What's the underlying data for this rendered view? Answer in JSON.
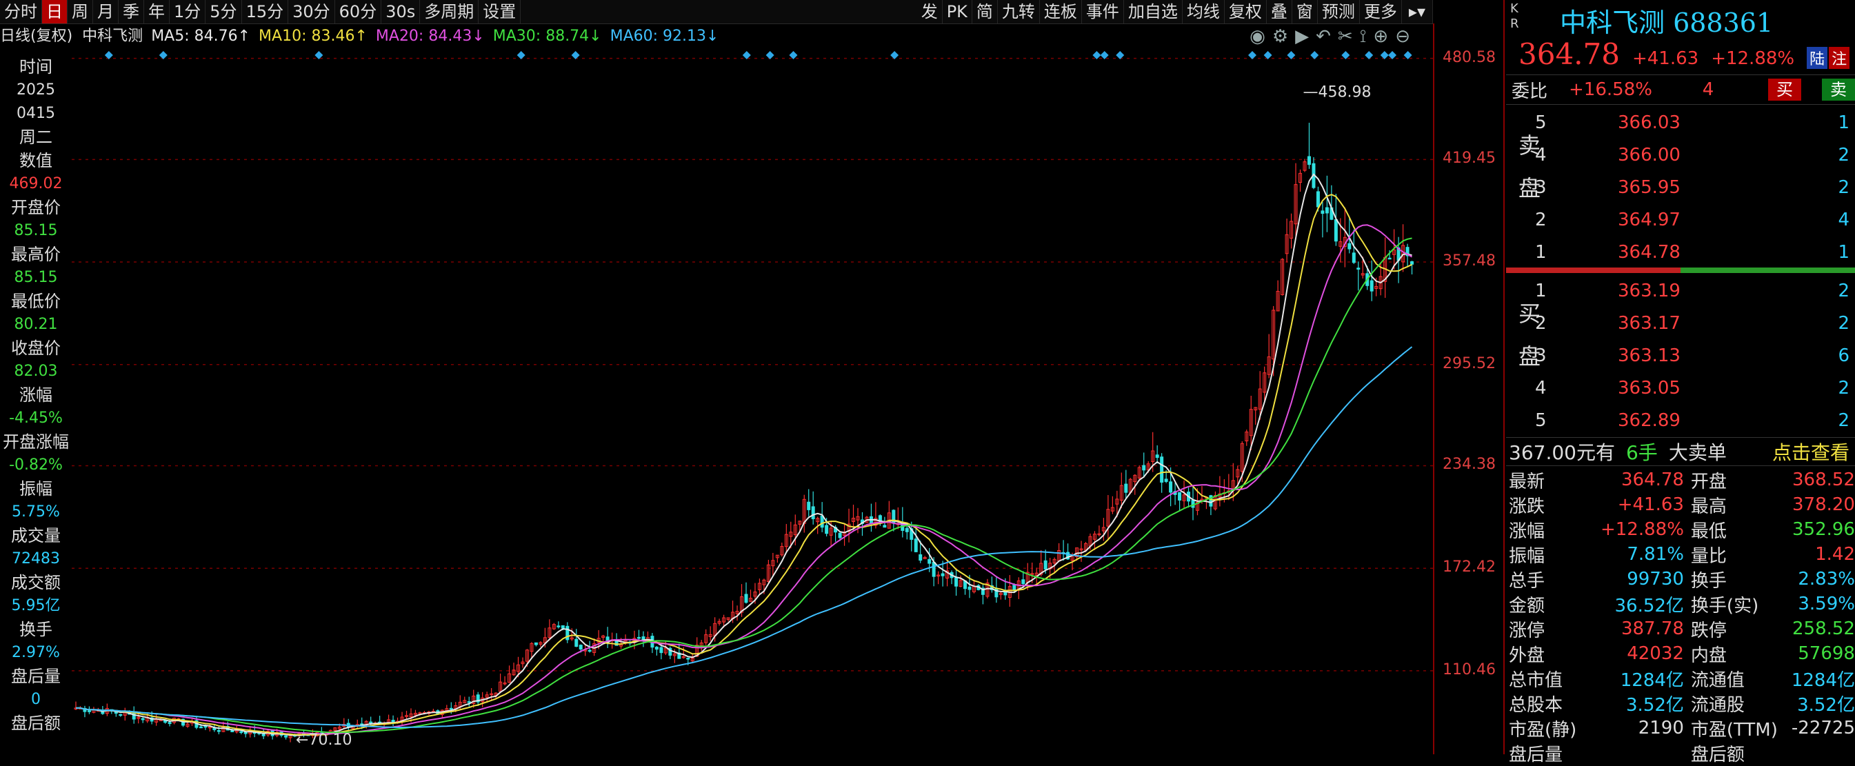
{
  "toolbar": {
    "left": [
      "分时",
      "日",
      "周",
      "月",
      "季",
      "年",
      "1分",
      "5分",
      "15分",
      "30分",
      "60分",
      "30s",
      "多周期",
      "设置"
    ],
    "active_index": 1,
    "right": [
      "发",
      "PK",
      "简",
      "九转",
      "连板",
      "事件",
      "加自选",
      "均线",
      "复权",
      "叠",
      "窗",
      "预测",
      "更多"
    ]
  },
  "legend": {
    "period": "日线(复权)",
    "stock": "中科飞测",
    "ma": [
      {
        "label": "MA5: 84.76↑",
        "color": "#e8e8e8"
      },
      {
        "label": "MA10: 83.46↑",
        "color": "#f0e040"
      },
      {
        "label": "MA20: 84.43↓",
        "color": "#e050e0"
      },
      {
        "label": "MA30: 88.74↓",
        "color": "#40e040"
      },
      {
        "label": "MA60: 92.13↓",
        "color": "#40c0ff"
      }
    ]
  },
  "left_panel": [
    {
      "label": "时间",
      "value": "2025"
    },
    {
      "label": "",
      "value": "0415"
    },
    {
      "label": "周二",
      "value": ""
    },
    {
      "label": "数值",
      "value": "469.02"
    },
    {
      "label": "开盘价",
      "value": "85.15"
    },
    {
      "label": "最高价",
      "value": "85.15"
    },
    {
      "label": "最低价",
      "value": "80.21"
    },
    {
      "label": "收盘价",
      "value": "82.03"
    },
    {
      "label": "涨幅",
      "value": "-4.45%"
    },
    {
      "label": "开盘涨幅",
      "value": "-0.82%"
    },
    {
      "label": "振幅",
      "value": "5.75%"
    },
    {
      "label": "成交量",
      "value": "72483"
    },
    {
      "label": "成交额",
      "value": "5.95亿"
    },
    {
      "label": "换手",
      "value": "2.97%"
    },
    {
      "label": "盘后量",
      "value": "0"
    },
    {
      "label": "盘后额",
      "value": ""
    }
  ],
  "left_colors": {
    "2025": "#ddd",
    "0415": "#ddd",
    "469.02": "#ff4040",
    "85.15": "#40e040",
    "80.21": "#40e040",
    "82.03": "#40e040",
    "-4.45%": "#40e040",
    "-0.82%": "#40e040",
    "5.75%": "#2ed0ff",
    "72483": "#2ed0ff",
    "5.95亿": "#2ed0ff",
    "2.97%": "#2ed0ff",
    "0": "#2ed0ff"
  },
  "axis_labels": [
    "480.58",
    "419.45",
    "357.48",
    "295.52",
    "234.38",
    "172.42",
    "110.46"
  ],
  "chart_data": {
    "type": "line",
    "series": [
      {
        "name": "MA5",
        "color": "#e8e8e8"
      },
      {
        "name": "MA10",
        "color": "#f0e040"
      },
      {
        "name": "MA20",
        "color": "#e050e0"
      },
      {
        "name": "MA30",
        "color": "#40e040"
      },
      {
        "name": "MA60",
        "color": "#40c0ff"
      }
    ],
    "ylim": [
      60,
      485
    ],
    "gridlines": [
      480.58,
      419.45,
      357.48,
      295.52,
      234.38,
      172.42,
      110.46
    ],
    "annotations": [
      {
        "text": "458.98",
        "value": 458.98
      },
      {
        "text": "←70.10",
        "value": 70.1
      }
    ],
    "close_path": [
      [
        0,
        88
      ],
      [
        20,
        86
      ],
      [
        40,
        82
      ],
      [
        60,
        80
      ],
      [
        80,
        76
      ],
      [
        100,
        74
      ],
      [
        120,
        72
      ],
      [
        130,
        71
      ],
      [
        150,
        74
      ],
      [
        170,
        78
      ],
      [
        190,
        80
      ],
      [
        210,
        84
      ],
      [
        230,
        90
      ],
      [
        250,
        96
      ],
      [
        260,
        104
      ],
      [
        270,
        118
      ],
      [
        280,
        130
      ],
      [
        290,
        138
      ],
      [
        300,
        128
      ],
      [
        310,
        125
      ],
      [
        320,
        130
      ],
      [
        330,
        128
      ],
      [
        340,
        132
      ],
      [
        350,
        126
      ],
      [
        360,
        122
      ],
      [
        370,
        118
      ],
      [
        380,
        130
      ],
      [
        390,
        140
      ],
      [
        400,
        150
      ],
      [
        410,
        160
      ],
      [
        420,
        176
      ],
      [
        430,
        190
      ],
      [
        440,
        210
      ],
      [
        450,
        196
      ],
      [
        460,
        190
      ],
      [
        470,
        200
      ],
      [
        480,
        198
      ],
      [
        490,
        202
      ],
      [
        500,
        196
      ],
      [
        510,
        178
      ],
      [
        520,
        170
      ],
      [
        530,
        165
      ],
      [
        540,
        162
      ],
      [
        550,
        160
      ],
      [
        560,
        158
      ],
      [
        570,
        163
      ],
      [
        580,
        170
      ],
      [
        590,
        178
      ],
      [
        600,
        182
      ],
      [
        610,
        188
      ],
      [
        620,
        200
      ],
      [
        630,
        215
      ],
      [
        640,
        232
      ],
      [
        650,
        242
      ],
      [
        660,
        222
      ],
      [
        670,
        214
      ],
      [
        680,
        210
      ],
      [
        690,
        212
      ],
      [
        700,
        230
      ],
      [
        710,
        262
      ],
      [
        720,
        300
      ],
      [
        730,
        360
      ],
      [
        740,
        420
      ],
      [
        750,
        395
      ],
      [
        760,
        380
      ],
      [
        770,
        360
      ],
      [
        780,
        345
      ],
      [
        790,
        352
      ],
      [
        800,
        360
      ],
      [
        810,
        365
      ]
    ],
    "ma_levels": [
      [
        0,
        90
      ],
      [
        100,
        76
      ],
      [
        200,
        90
      ],
      [
        300,
        122
      ],
      [
        400,
        148
      ],
      [
        500,
        192
      ],
      [
        560,
        176
      ],
      [
        600,
        180
      ],
      [
        660,
        205
      ],
      [
        720,
        280
      ],
      [
        760,
        330
      ],
      [
        810,
        365
      ]
    ]
  },
  "markers": [
    3,
    10,
    30,
    56,
    63,
    85,
    88,
    91,
    104,
    130,
    131,
    133,
    150,
    152,
    155,
    158,
    162,
    165,
    167,
    168,
    170
  ],
  "right": {
    "kr": [
      "K",
      "R"
    ],
    "name": "中科飞测 688361",
    "price": "364.78",
    "change": "+41.63",
    "pct": "+12.88%",
    "badge_lu": "陆",
    "badge_zhu": "注",
    "weibi_label": "委比",
    "weibi_value": "+16.58%",
    "weibi_count": "4",
    "buy_btn": "买",
    "sell_btn": "卖",
    "sell_side": "卖盘",
    "buy_side": "买盘",
    "asks": [
      {
        "lv": "5",
        "price": "366.03",
        "vol": "1"
      },
      {
        "lv": "4",
        "price": "366.00",
        "vol": "2"
      },
      {
        "lv": "3",
        "price": "365.95",
        "vol": "2"
      },
      {
        "lv": "2",
        "price": "364.97",
        "vol": "4"
      },
      {
        "lv": "1",
        "price": "364.78",
        "vol": "1"
      }
    ],
    "bids": [
      {
        "lv": "1",
        "price": "363.19",
        "vol": "2"
      },
      {
        "lv": "2",
        "price": "363.17",
        "vol": "2"
      },
      {
        "lv": "3",
        "price": "363.13",
        "vol": "6"
      },
      {
        "lv": "4",
        "price": "363.05",
        "vol": "2"
      },
      {
        "lv": "5",
        "price": "362.89",
        "vol": "2"
      }
    ],
    "big_order": {
      "amount": "367.00元有",
      "hands": "6手",
      "label": "大卖单",
      "link": "点击查看"
    },
    "quote_rows": [
      [
        "最新",
        "364.78",
        "开盘",
        "368.52"
      ],
      [
        "涨跌",
        "+41.63",
        "最高",
        "378.20"
      ],
      [
        "涨幅",
        "+12.88%",
        "最低",
        "352.96"
      ],
      [
        "振幅",
        "7.81%",
        "量比",
        "1.42"
      ],
      [
        "总手",
        "99730",
        "换手",
        "2.83%"
      ],
      [
        "金额",
        "36.52亿",
        "换手(实)",
        "3.59%"
      ],
      [
        "涨停",
        "387.78",
        "跌停",
        "258.52"
      ],
      [
        "外盘",
        "42032",
        "内盘",
        "57698"
      ],
      [
        "总市值",
        "1284亿",
        "流通值",
        "1284亿"
      ],
      [
        "总股本",
        "3.52亿",
        "流通股",
        "3.52亿"
      ],
      [
        "市盈(静)",
        "2190",
        "市盈(TTM)",
        "-22725"
      ],
      [
        "盘后量",
        "",
        "盘后额",
        ""
      ]
    ],
    "quote_colors": [
      [
        "#ff4040",
        "#ff4040"
      ],
      [
        "#ff4040",
        "#ff4040"
      ],
      [
        "#ff4040",
        "#40e040"
      ],
      [
        "#2ed0ff",
        "#ff4040"
      ],
      [
        "#2ed0ff",
        "#2ed0ff"
      ],
      [
        "#2ed0ff",
        "#2ed0ff"
      ],
      [
        "#ff4040",
        "#40e040"
      ],
      [
        "#ff4040",
        "#40e040"
      ],
      [
        "#2ed0ff",
        "#2ed0ff"
      ],
      [
        "#2ed0ff",
        "#2ed0ff"
      ],
      [
        "#ddd",
        "#ddd"
      ],
      [
        "#ddd",
        "#ddd"
      ]
    ]
  }
}
